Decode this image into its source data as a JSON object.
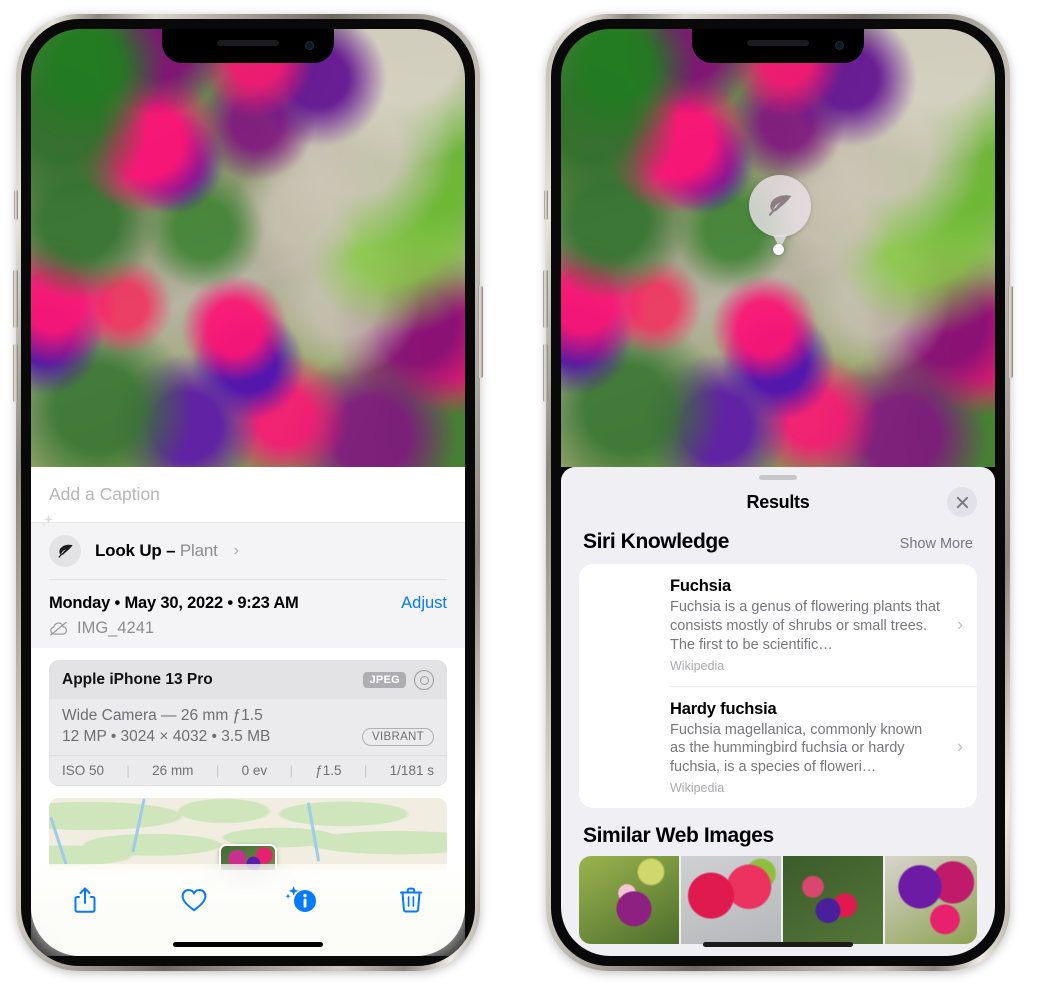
{
  "left_phone": {
    "photo": {
      "alt": "fuchsia-flowers-photo"
    },
    "caption": {
      "placeholder": "Add a Caption",
      "value": ""
    },
    "lookup": {
      "icon": "leaf-icon",
      "label": "Look Up – ",
      "category": "Plant",
      "chevron": "›"
    },
    "meta": {
      "date": "Monday • May 30, 2022 • 9:23 AM",
      "adjust_label": "Adjust",
      "cloud_icon": "cloud-slash-icon",
      "filename": "IMG_4241"
    },
    "camera_card": {
      "model": "Apple iPhone 13 Pro",
      "format_badge": "JPEG",
      "lens_icon": "aperture-icon",
      "lens_line": "Wide Camera — 26 mm ƒ1.5",
      "specs_line": "12 MP • 3024 × 4032 • 3.5 MB",
      "style_badge": "VIBRANT",
      "exif": [
        {
          "label": "ISO 50"
        },
        {
          "label": "26 mm"
        },
        {
          "label": "0 ev"
        },
        {
          "label": "ƒ1.5"
        },
        {
          "label": "1/181 s"
        }
      ]
    },
    "map": {
      "name": "location-map-preview"
    },
    "toolbar": [
      {
        "name": "share-button",
        "icon": "share-icon"
      },
      {
        "name": "favorite-button",
        "icon": "heart-icon"
      },
      {
        "name": "info-button",
        "icon": "info-sparkle-icon"
      },
      {
        "name": "delete-button",
        "icon": "trash-icon"
      }
    ]
  },
  "right_phone": {
    "photo": {
      "alt": "fuchsia-flowers-photo"
    },
    "detection_badge": {
      "icon": "leaf-icon"
    },
    "sheet": {
      "title": "Results",
      "close_label": "✕",
      "sections": [
        {
          "title": "Siri Knowledge",
          "action": "Show More",
          "items": [
            {
              "title": "Fuchsia",
              "description": "Fuchsia is a genus of flowering plants that consists mostly of shrubs or small trees. The first to be scientific…",
              "source": "Wikipedia",
              "chevron": "›"
            },
            {
              "title": "Hardy fuchsia",
              "description": "Fuchsia magellanica, commonly known as the hummingbird fuchsia or hardy fuchsia, is a species of floweri…",
              "source": "Wikipedia",
              "chevron": "›"
            }
          ]
        },
        {
          "title": "Similar Web Images",
          "items": [
            {
              "name": "web-image-1"
            },
            {
              "name": "web-image-2"
            },
            {
              "name": "web-image-3"
            },
            {
              "name": "web-image-4"
            }
          ]
        }
      ]
    }
  },
  "colors": {
    "accent_blue": "#067aff",
    "sheet_bg": "#f0eff4",
    "card_bg": "#ffffff",
    "secondary_text": "#77767d"
  }
}
